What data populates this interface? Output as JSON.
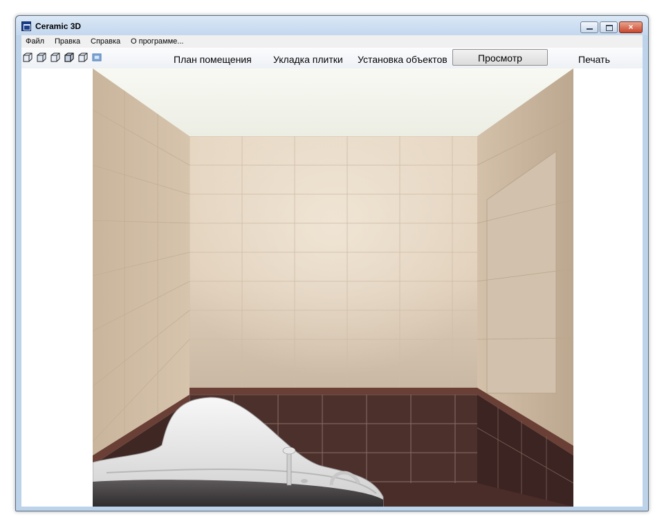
{
  "window": {
    "title": "Ceramic 3D",
    "close_glyph": "×"
  },
  "menu": [
    {
      "label": "Файл"
    },
    {
      "label": "Правка"
    },
    {
      "label": "Справка"
    },
    {
      "label": "О программе..."
    }
  ],
  "toolbar_icons": [
    "view-cube-1-icon",
    "view-cube-2-icon",
    "view-cube-3-icon",
    "view-cube-4-icon",
    "view-cube-5-icon",
    "render-view-icon"
  ],
  "tabs": [
    {
      "label": "План помещения",
      "active": false
    },
    {
      "label": "Укладка плитки",
      "active": false
    },
    {
      "label": "Установка объектов",
      "active": false
    },
    {
      "label": "Просмотр",
      "active": true
    },
    {
      "label": "Печать",
      "active": false
    }
  ],
  "colors": {
    "wall_tile": "#e0d0bb",
    "floor_tile": "#4b2f2c",
    "ceiling": "#f4f5ee",
    "accent_border": "#6a3f35"
  }
}
